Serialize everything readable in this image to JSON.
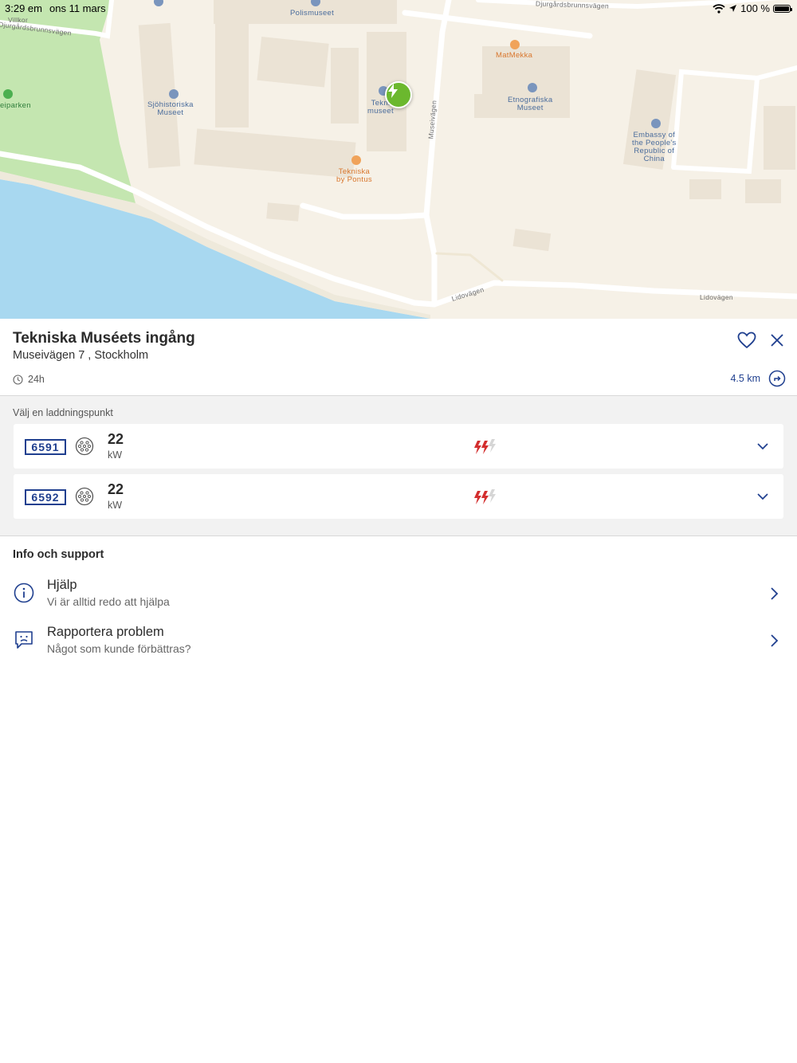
{
  "status_bar": {
    "time": "3:29 em",
    "date": "ons 11 mars",
    "battery": "100 %"
  },
  "map": {
    "labels": {
      "polismuseet": "Polismuseet",
      "djurgardsbrunnsvagen_top": "Djurgårdsbrunnsvägen",
      "villkor": "Villkor",
      "djurgardsbrunnsvagen_left": "Djurgårdsbrunnsvägen",
      "sjohistoriska": [
        "Sjöhistoriska",
        "Museet"
      ],
      "parken": "eiparken",
      "tekniska_museet": [
        "Tekni",
        "museet"
      ],
      "tekniska_pontus": [
        "Tekniska",
        "by Pontus"
      ],
      "museivagen": "Museivägen",
      "matmekka": "MatMekka",
      "etnografiska": [
        "Etnografiska",
        "Museet"
      ],
      "embassy": [
        "Embassy of",
        "the People's",
        "Republic of",
        "China"
      ],
      "lidovagen_1": "Lidovägen",
      "lidovagen_2": "Lidovägen"
    },
    "colors": {
      "land": "#f6f1e7",
      "water": "#a8d8f0",
      "park": "#c4e6b0",
      "road": "#ffffff",
      "charger": "#6bb82e"
    }
  },
  "station": {
    "name": "Tekniska Muséets ingång",
    "address": "Museivägen 7 , Stockholm",
    "hours": "24h",
    "distance": "4.5 km"
  },
  "charging_points": {
    "heading": "Välj en laddningspunkt",
    "items": [
      {
        "id": "6591",
        "power": "22",
        "unit": "kW"
      },
      {
        "id": "6592",
        "power": "22",
        "unit": "kW"
      }
    ]
  },
  "support": {
    "heading": "Info och support",
    "items": [
      {
        "title": "Hjälp",
        "subtitle": "Vi är alltid redo att hjälpa",
        "icon": "info-icon"
      },
      {
        "title": "Rapportera problem",
        "subtitle": "Något som kunde förbättras?",
        "icon": "sad-chat-icon"
      }
    ]
  },
  "accent_color": "#1f3f8f"
}
